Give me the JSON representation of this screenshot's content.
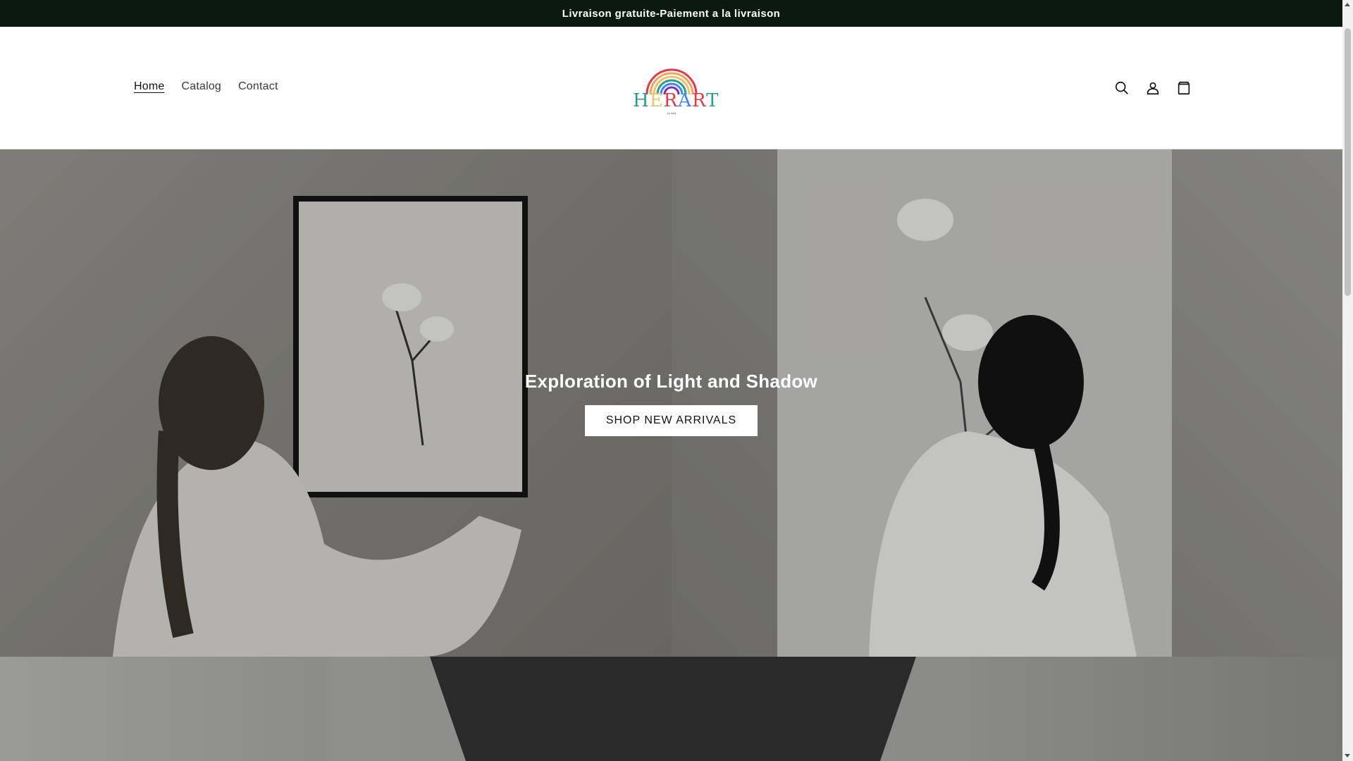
{
  "announcement": {
    "text": "Livraison gratuite-Paiement a la livraison"
  },
  "header": {
    "nav": [
      {
        "label": "Home",
        "active": true
      },
      {
        "label": "Catalog",
        "active": false
      },
      {
        "label": "Contact",
        "active": false
      }
    ],
    "logo": {
      "text": "HERART",
      "subtext": "by mila",
      "colors": [
        "#e63946",
        "#f4a261",
        "#2a9d8f",
        "#264653",
        "#e9c46a",
        "#3a86ff"
      ]
    },
    "icons": [
      "search-icon",
      "account-icon",
      "cart-icon"
    ]
  },
  "hero": {
    "title": "Exploration of Light and Shadow",
    "button_label": "SHOP NEW ARRIVALS"
  },
  "colors": {
    "announcement_bg": "#0a1a10",
    "text": "#121212"
  }
}
